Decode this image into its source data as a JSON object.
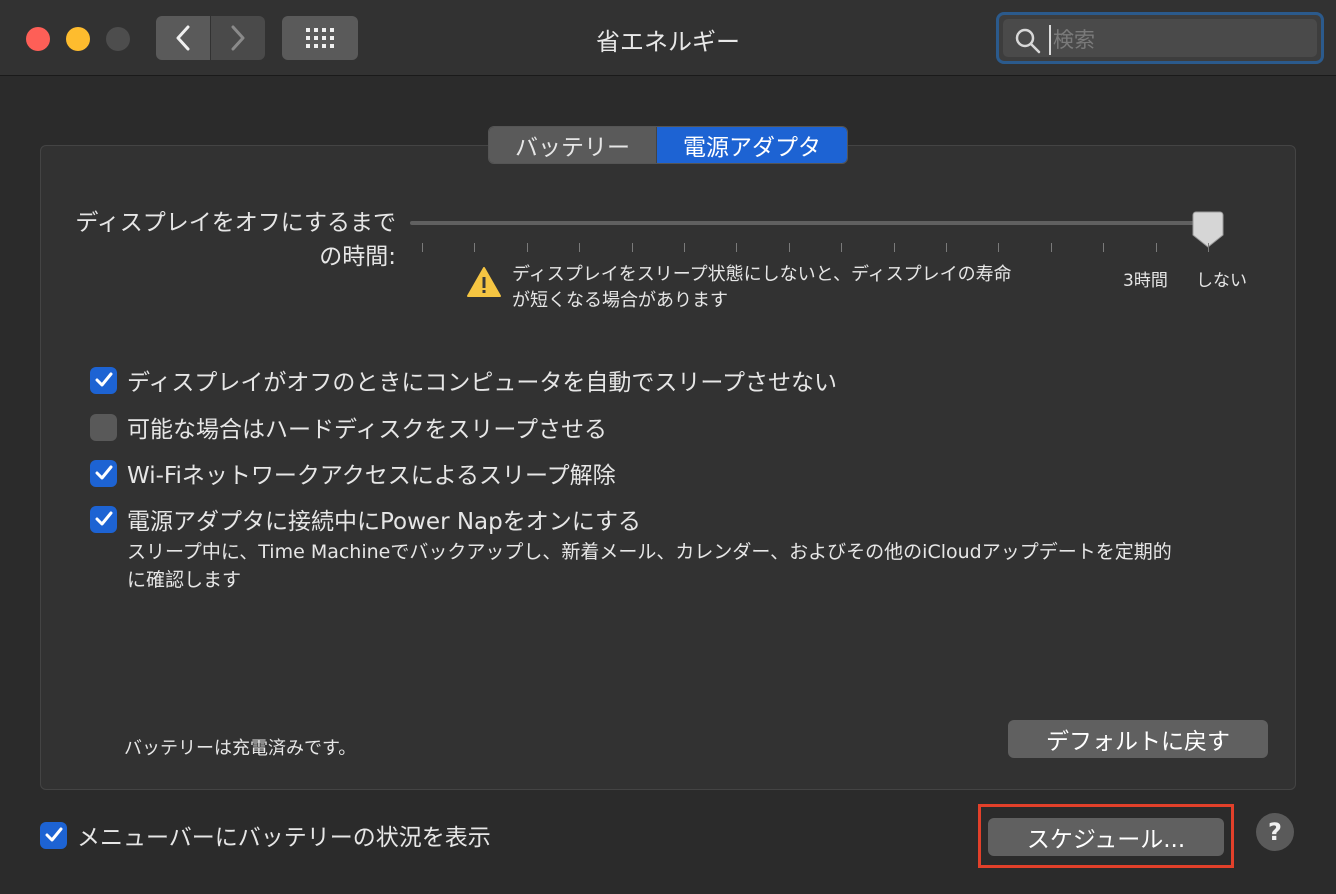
{
  "window": {
    "title": "省エネルギー"
  },
  "search": {
    "placeholder": "検索"
  },
  "tabs": [
    {
      "label": "バッテリー",
      "selected": false
    },
    {
      "label": "電源アダプタ",
      "selected": true
    }
  ],
  "display_sleep": {
    "label_line1": "ディスプレイをオフにするまで",
    "label_line2": "の時間:",
    "tick_labels": [
      "3時間",
      "しない"
    ],
    "value": "しない",
    "warning_line1": "ディスプレイをスリープ状態にしないと、ディスプレイの寿命",
    "warning_line2": "が短くなる場合があります"
  },
  "options": [
    {
      "label": "ディスプレイがオフのときにコンピュータを自動でスリープさせない",
      "checked": true
    },
    {
      "label": "可能な場合はハードディスクをスリープさせる",
      "checked": false
    },
    {
      "label": "Wi-Fiネットワークアクセスによるスリープ解除",
      "checked": true
    },
    {
      "label": "電源アダプタに接続中にPower Napをオンにする",
      "checked": true
    }
  ],
  "power_nap_description_line1": "スリープ中に、Time Machineでバックアップし、新着メール、カレンダー、およびその他のiCloudアップデートを定期的",
  "power_nap_description_line2": "に確認します",
  "status_text": "バッテリーは充電済みです。",
  "buttons": {
    "restore_defaults": "デフォルトに戻す",
    "schedule": "スケジュール...",
    "help": "?"
  },
  "menubar_option": {
    "label": "メニューバーにバッテリーの状況を表示",
    "checked": true
  },
  "colors": {
    "accent": "#1d63d3",
    "highlight_box": "#e2402a",
    "warning": "#f5c542"
  }
}
